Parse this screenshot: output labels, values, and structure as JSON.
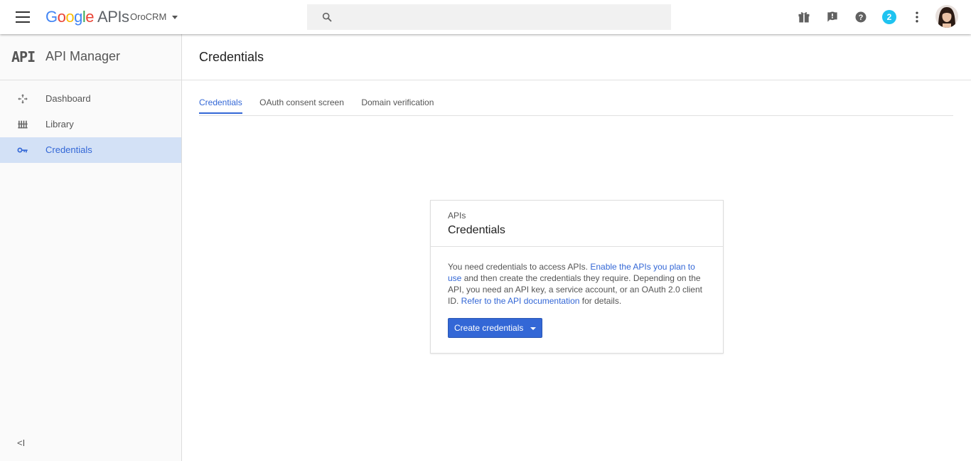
{
  "topbar": {
    "logo": [
      "G",
      "o",
      "o",
      "g",
      "l",
      "e"
    ],
    "product": "APIs",
    "project": "OroCRM",
    "search_placeholder": "",
    "notification_count": "2"
  },
  "sidebar": {
    "glyph": "API",
    "title": "API Manager",
    "items": [
      {
        "label": "Dashboard",
        "icon": "dashboard-icon"
      },
      {
        "label": "Library",
        "icon": "library-icon"
      },
      {
        "label": "Credentials",
        "icon": "key-icon",
        "active": true
      }
    ],
    "collapse_label": "<I"
  },
  "main": {
    "title": "Credentials",
    "tabs": [
      {
        "label": "Credentials",
        "active": true
      },
      {
        "label": "OAuth consent screen"
      },
      {
        "label": "Domain verification"
      }
    ]
  },
  "card": {
    "subtitle": "APIs",
    "title": "Credentials",
    "text1": "You need credentials to access APIs. ",
    "link1": "Enable the APIs you plan to use",
    "text2": " and then create the credentials they require. Depending on the API, you need an API key, a service account, or an OAuth 2.0 client ID. ",
    "link2": "Refer to the API documentation",
    "text3": " for details.",
    "button": "Create credentials"
  },
  "colors": {
    "accent": "#3367d6",
    "active_bg": "#d3e1f6",
    "badge": "#1fc3f0"
  }
}
